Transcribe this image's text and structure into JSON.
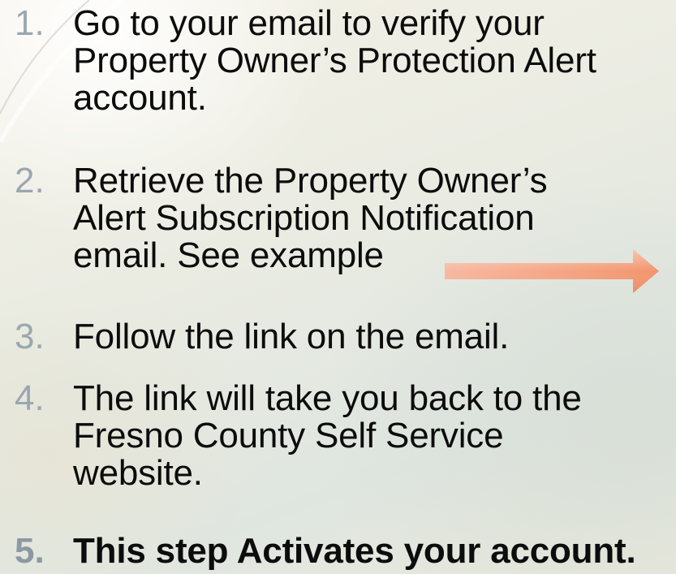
{
  "steps": [
    {
      "number": "1.",
      "lines": [
        "Go to your email to verify your",
        "Property Owner’s Protection Alert",
        "account."
      ]
    },
    {
      "number": "2.",
      "lines": [
        "Retrieve the Property Owner’s",
        "Alert Subscription Notification",
        "email. See example"
      ]
    },
    {
      "number": "3.",
      "lines": [
        "Follow the link on the email."
      ]
    },
    {
      "number": "4.",
      "lines": [
        "The link will take you back to the",
        "Fresno County Self Service",
        "website."
      ]
    },
    {
      "number": "5.",
      "lines": [
        "This step Activates your account."
      ]
    }
  ],
  "colors": {
    "text": "#0c0c0c",
    "number": "#9aa7b0",
    "arrow_start": "#f7b8a0",
    "arrow_end": "#f2946c"
  }
}
